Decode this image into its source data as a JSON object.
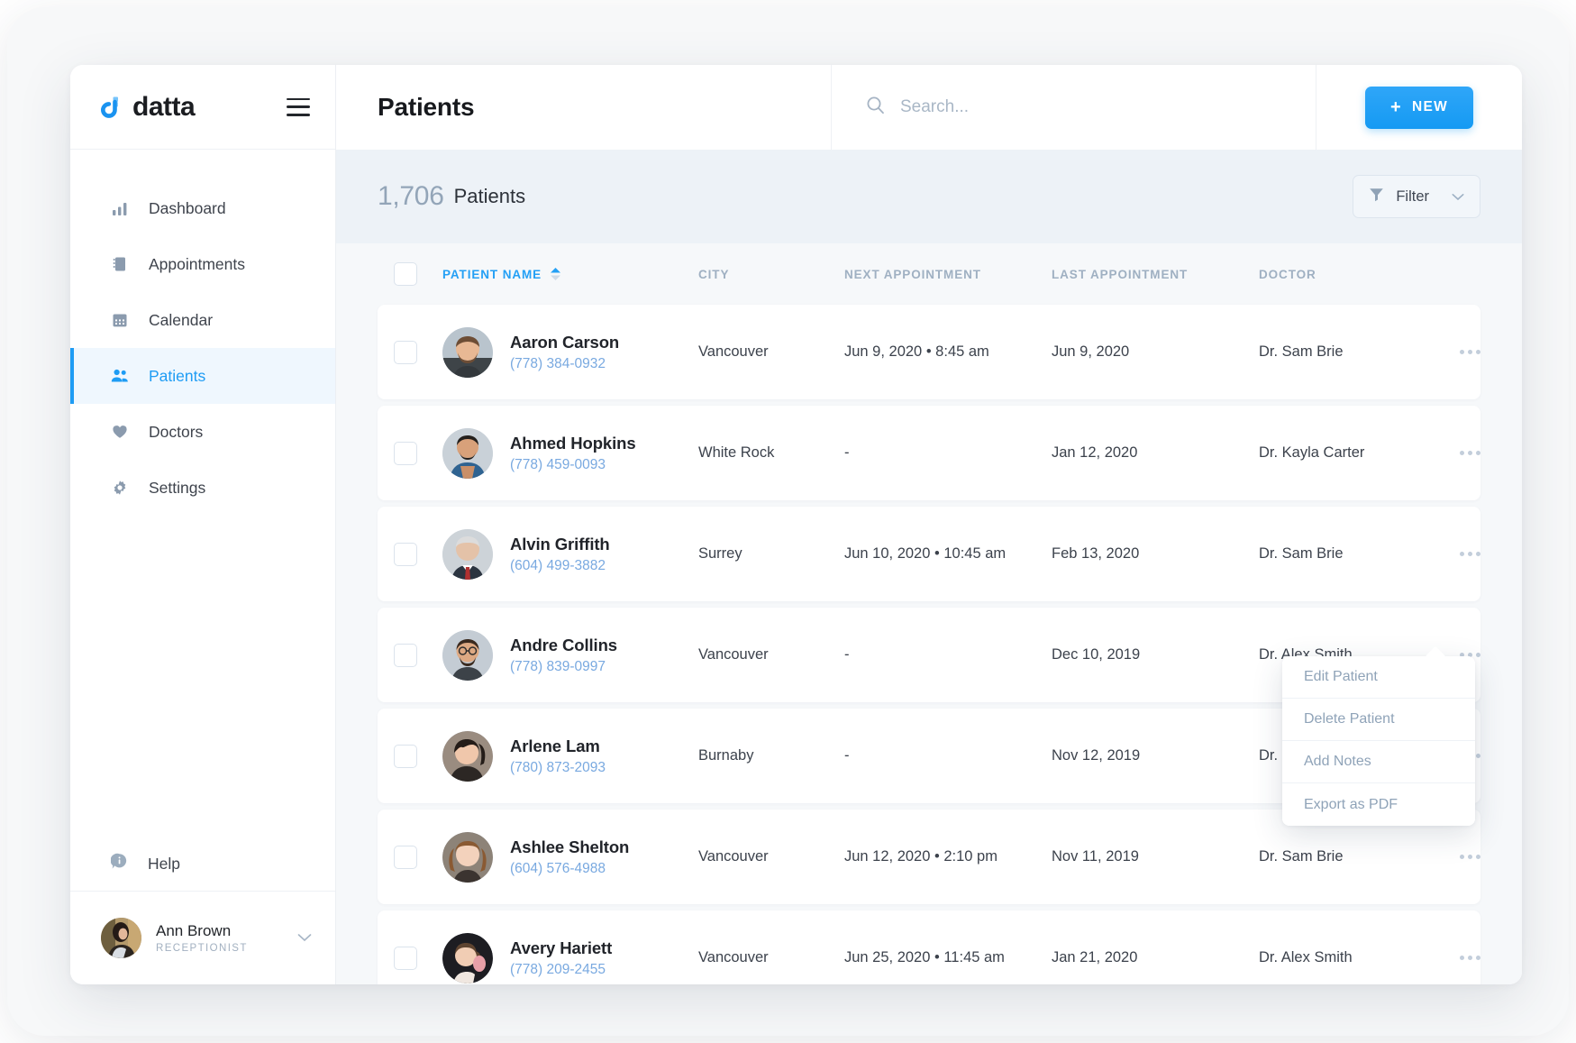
{
  "brand": {
    "name": "datta",
    "logo_icon": "datta-logo-icon",
    "accent": "#1e9cf4"
  },
  "sidebar": {
    "menu_icon": "hamburger-icon",
    "items": [
      {
        "label": "Dashboard",
        "icon": "bar-chart-icon",
        "active": false
      },
      {
        "label": "Appointments",
        "icon": "book-icon",
        "active": false
      },
      {
        "label": "Calendar",
        "icon": "calendar-icon",
        "active": false
      },
      {
        "label": "Patients",
        "icon": "people-icon",
        "active": true
      },
      {
        "label": "Doctors",
        "icon": "heart-icon",
        "active": false
      },
      {
        "label": "Settings",
        "icon": "gear-icon",
        "active": false
      }
    ],
    "help": {
      "label": "Help",
      "icon": "info-icon"
    },
    "user": {
      "name": "Ann Brown",
      "role": "RECEPTIONIST",
      "avatar": "user-avatar",
      "caret": "chevron-down-icon"
    }
  },
  "header": {
    "title": "Patients",
    "search": {
      "placeholder": "Search...",
      "value": "",
      "icon": "search-icon"
    },
    "new_button": {
      "label": "NEW",
      "plus": "+"
    }
  },
  "countbar": {
    "count": "1,706",
    "label": "Patients",
    "filter": {
      "label": "Filter",
      "icon": "funnel-icon",
      "caret": "chevron-down-icon"
    }
  },
  "table": {
    "columns": [
      {
        "key": "name",
        "label": "Patient Name",
        "sorted": true,
        "sort_dir": "asc"
      },
      {
        "key": "city",
        "label": "City",
        "sorted": false
      },
      {
        "key": "next",
        "label": "Next Appointment",
        "sorted": false
      },
      {
        "key": "last",
        "label": "Last Appointment",
        "sorted": false
      },
      {
        "key": "doc",
        "label": "Doctor",
        "sorted": false
      }
    ],
    "rows": [
      {
        "name": "Aaron Carson",
        "phone": "(778) 384-0932",
        "city": "Vancouver",
        "next": "Jun 9, 2020 • 8:45 am",
        "last": "Jun 9, 2020",
        "doctor": "Dr. Sam Brie",
        "avatar_color": "#9aa7b4"
      },
      {
        "name": "Ahmed Hopkins",
        "phone": "(778) 459-0093",
        "city": "White Rock",
        "next": "-",
        "last": "Jan 12, 2020",
        "doctor": "Dr. Kayla Carter",
        "avatar_color": "#7b8694"
      },
      {
        "name": "Alvin Griffith",
        "phone": "(604) 499-3882",
        "city": "Surrey",
        "next": "Jun 10, 2020 • 10:45 am",
        "last": "Feb 13, 2020",
        "doctor": "Dr. Sam Brie",
        "avatar_color": "#a7a097"
      },
      {
        "name": "Andre Collins",
        "phone": "(778) 839-0997",
        "city": "Vancouver",
        "next": "-",
        "last": "Dec 10, 2019",
        "doctor": "Dr. Alex Smith",
        "avatar_color": "#8d9299"
      },
      {
        "name": "Arlene Lam",
        "phone": "(780) 873-2093",
        "city": "Burnaby",
        "next": "-",
        "last": "Nov 12, 2019",
        "doctor": "Dr. Sam Brie",
        "avatar_color": "#b39585"
      },
      {
        "name": "Ashlee Shelton",
        "phone": "(604) 576-4988",
        "city": "Vancouver",
        "next": "Jun 12, 2020 • 2:10 pm",
        "last": "Nov 11, 2019",
        "doctor": "Dr. Sam Brie",
        "avatar_color": "#c2a089"
      },
      {
        "name": "Avery Hariett",
        "phone": "(778) 209-2455",
        "city": "Vancouver",
        "next": "Jun 25, 2020 • 11:45 am",
        "last": "Jan 21, 2020",
        "doctor": "Dr. Alex Smith",
        "avatar_color": "#2a2c33"
      }
    ],
    "row_menu_icon": "more-horizontal-icon"
  },
  "context_menu": {
    "open_for_row": 1,
    "items": [
      {
        "label": "Edit Patient"
      },
      {
        "label": "Delete Patient"
      },
      {
        "label": "Add Notes"
      },
      {
        "label": "Export as PDF"
      }
    ]
  }
}
